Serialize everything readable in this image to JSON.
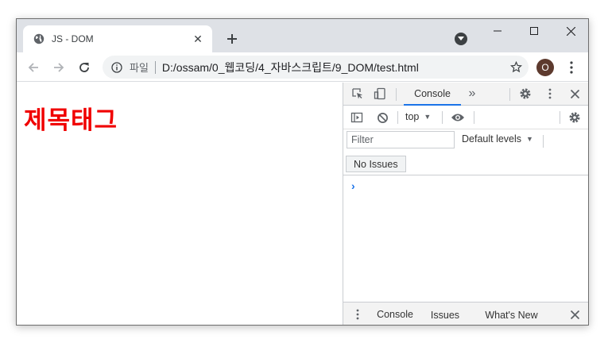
{
  "tab": {
    "title": "JS - DOM",
    "close": "✕"
  },
  "newtab_symbol": "+",
  "address": {
    "scheme_label": "파일",
    "url": "D:/ossam/0_웹코딩/4_자바스크립트/9_DOM/test.html"
  },
  "profile_initial": "O",
  "page": {
    "heading": "제목태그"
  },
  "devtools": {
    "tab_console": "Console",
    "more_tabs": "»",
    "context": "top",
    "filter_placeholder": "Filter",
    "levels": "Default levels",
    "no_issues": "No Issues",
    "prompt": "›",
    "drawer_tabs": [
      "Console",
      "Issues",
      "What's New"
    ],
    "dropdown_arrow": "▼"
  },
  "colors": {
    "heading": "#f00000",
    "accent": "#1a73e8",
    "tabstrip": "#dee1e6"
  }
}
